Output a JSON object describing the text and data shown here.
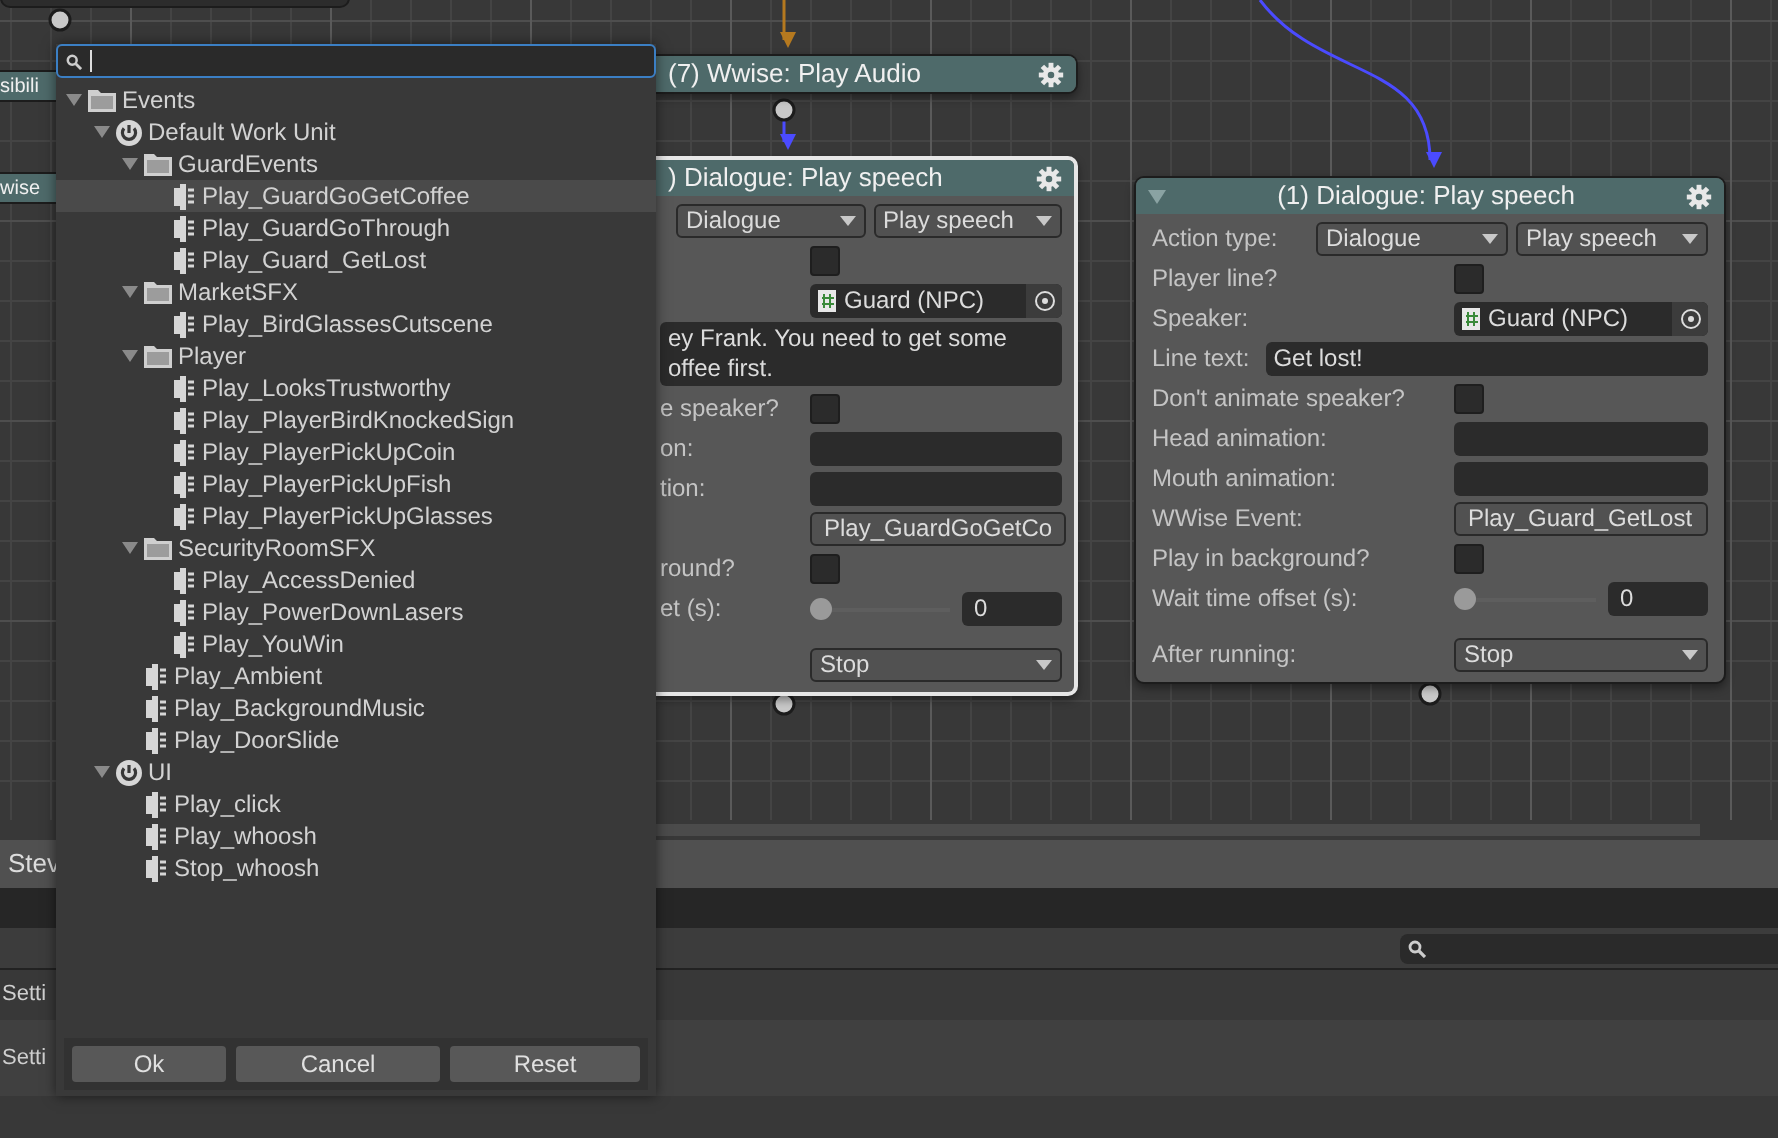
{
  "graph": {
    "fragments": [
      {
        "title": "sibili"
      },
      {
        "title": "wise"
      }
    ],
    "nodes": [
      {
        "title": "(7) Wwise: Play Audio",
        "selected": false
      },
      {
        "title": ") Dialogue: Play speech",
        "selected": true,
        "rows": [
          {
            "kind": "dropdowns",
            "values": [
              "Dialogue",
              "Play speech"
            ]
          },
          {
            "kind": "checkbox",
            "checked": false
          },
          {
            "kind": "object",
            "value": "Guard (NPC)"
          },
          {
            "kind": "text",
            "lines": [
              "ey Frank. You need to get some",
              "offee first."
            ]
          },
          {
            "kind": "checkbox",
            "label": "e speaker?",
            "checked": false
          },
          {
            "kind": "field",
            "label": "on:"
          },
          {
            "kind": "field",
            "label": "tion:"
          },
          {
            "kind": "field",
            "value": "Play_GuardGoGetCo"
          },
          {
            "kind": "checkbox",
            "label": "round?",
            "checked": false
          },
          {
            "kind": "slider",
            "label": "et (s):",
            "level": 0,
            "value": "0"
          },
          {
            "kind": "dropdown",
            "value": "Stop"
          }
        ]
      },
      {
        "title": "(1) Dialogue: Play speech",
        "selected": false,
        "expanded": true,
        "rows": [
          {
            "kind": "dropdowns",
            "label": "Action type:",
            "values": [
              "Dialogue",
              "Play speech"
            ]
          },
          {
            "kind": "checkbox",
            "label": "Player line?",
            "checked": false
          },
          {
            "kind": "object",
            "label": "Speaker:",
            "value": "Guard (NPC)"
          },
          {
            "kind": "text",
            "label": "Line text:",
            "lines": [
              "Get lost!"
            ]
          },
          {
            "kind": "checkbox",
            "label": "Don't animate speaker?",
            "checked": false
          },
          {
            "kind": "field",
            "label": "Head animation:"
          },
          {
            "kind": "field",
            "label": "Mouth animation:"
          },
          {
            "kind": "field",
            "label": "WWise Event:",
            "value": "Play_Guard_GetLost"
          },
          {
            "kind": "checkbox",
            "label": "Play in background?",
            "checked": false
          },
          {
            "kind": "slider",
            "label": "Wait time offset (s):",
            "level": 0,
            "value": "0"
          },
          {
            "kind": "dropdown",
            "label": "After running:",
            "value": "Stop"
          }
        ]
      }
    ]
  },
  "panel": {
    "tab": "Stev",
    "rows": [
      "Setti",
      "Setti"
    ]
  },
  "picker": {
    "tree": [
      {
        "kind": "folder",
        "label": "Events",
        "expanded": true,
        "selected": false,
        "children": [
          {
            "kind": "workunit",
            "label": "Default Work Unit",
            "expanded": true,
            "selected": false,
            "children": [
              {
                "kind": "folder",
                "label": "GuardEvents",
                "expanded": true,
                "selected": false,
                "children": [
                  {
                    "kind": "event",
                    "label": "Play_GuardGoGetCoffee",
                    "selected": true
                  },
                  {
                    "kind": "event",
                    "label": "Play_GuardGoThrough",
                    "selected": false
                  },
                  {
                    "kind": "event",
                    "label": "Play_Guard_GetLost",
                    "selected": false
                  }
                ]
              },
              {
                "kind": "folder",
                "label": "MarketSFX",
                "expanded": true,
                "selected": false,
                "children": [
                  {
                    "kind": "event",
                    "label": "Play_BirdGlassesCutscene",
                    "selected": false
                  }
                ]
              },
              {
                "kind": "folder",
                "label": "Player",
                "expanded": true,
                "selected": false,
                "children": [
                  {
                    "kind": "event",
                    "label": "Play_LooksTrustworthy",
                    "selected": false
                  },
                  {
                    "kind": "event",
                    "label": "Play_PlayerBirdKnockedSign",
                    "selected": false
                  },
                  {
                    "kind": "event",
                    "label": "Play_PlayerPickUpCoin",
                    "selected": false
                  },
                  {
                    "kind": "event",
                    "label": "Play_PlayerPickUpFish",
                    "selected": false
                  },
                  {
                    "kind": "event",
                    "label": "Play_PlayerPickUpGlasses",
                    "selected": false
                  }
                ]
              },
              {
                "kind": "folder",
                "label": "SecurityRoomSFX",
                "expanded": true,
                "selected": false,
                "children": [
                  {
                    "kind": "event",
                    "label": "Play_AccessDenied",
                    "selected": false
                  },
                  {
                    "kind": "event",
                    "label": "Play_PowerDownLasers",
                    "selected": false
                  },
                  {
                    "kind": "event",
                    "label": "Play_YouWin",
                    "selected": false
                  }
                ]
              },
              {
                "kind": "event",
                "label": "Play_Ambient",
                "selected": false
              },
              {
                "kind": "event",
                "label": "Play_BackgroundMusic",
                "selected": false
              },
              {
                "kind": "event",
                "label": "Play_DoorSlide",
                "selected": false
              }
            ]
          },
          {
            "kind": "workunit",
            "label": "UI",
            "expanded": true,
            "selected": false,
            "children": [
              {
                "kind": "event",
                "label": "Play_click",
                "selected": false
              },
              {
                "kind": "event",
                "label": "Play_whoosh",
                "selected": false
              },
              {
                "kind": "event",
                "label": "Stop_whoosh",
                "selected": false
              }
            ]
          }
        ]
      }
    ],
    "buttons": [
      "Ok",
      "Cancel",
      "Reset"
    ]
  }
}
